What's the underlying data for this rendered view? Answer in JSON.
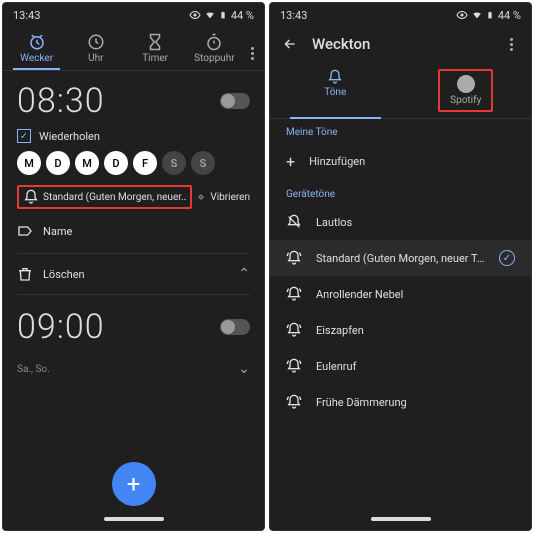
{
  "statusbar": {
    "time": "13:43",
    "battery": "44 %"
  },
  "left": {
    "tabs": {
      "wecker": "Wecker",
      "uhr": "Uhr",
      "timer": "Timer",
      "stoppuhr": "Stoppuhr"
    },
    "alarm1": {
      "time": "08:30",
      "repeat_label": "Wiederholen",
      "days": [
        "M",
        "D",
        "M",
        "D",
        "F",
        "S",
        "S"
      ],
      "sound": "Standard (Guten Morgen, neuer..",
      "vibrate": "Vibrieren",
      "name": "Name",
      "delete": "Löschen"
    },
    "alarm2": {
      "time": "09:00",
      "sub": "Sa., So."
    }
  },
  "right": {
    "title": "Weckton",
    "tabs": {
      "tone": "Töne",
      "spotify": "Spotify"
    },
    "section_my": "Meine Töne",
    "add": "Hinzufügen",
    "section_device": "Gerätetöne",
    "items": {
      "silent": "Lautlos",
      "standard": "Standard (Guten Morgen, neuer Tag!)",
      "nebel": "Anrollender Nebel",
      "eiszapfen": "Eiszapfen",
      "eulenruf": "Eulenruf",
      "fruhe": "Frühe Dämmerung"
    }
  }
}
